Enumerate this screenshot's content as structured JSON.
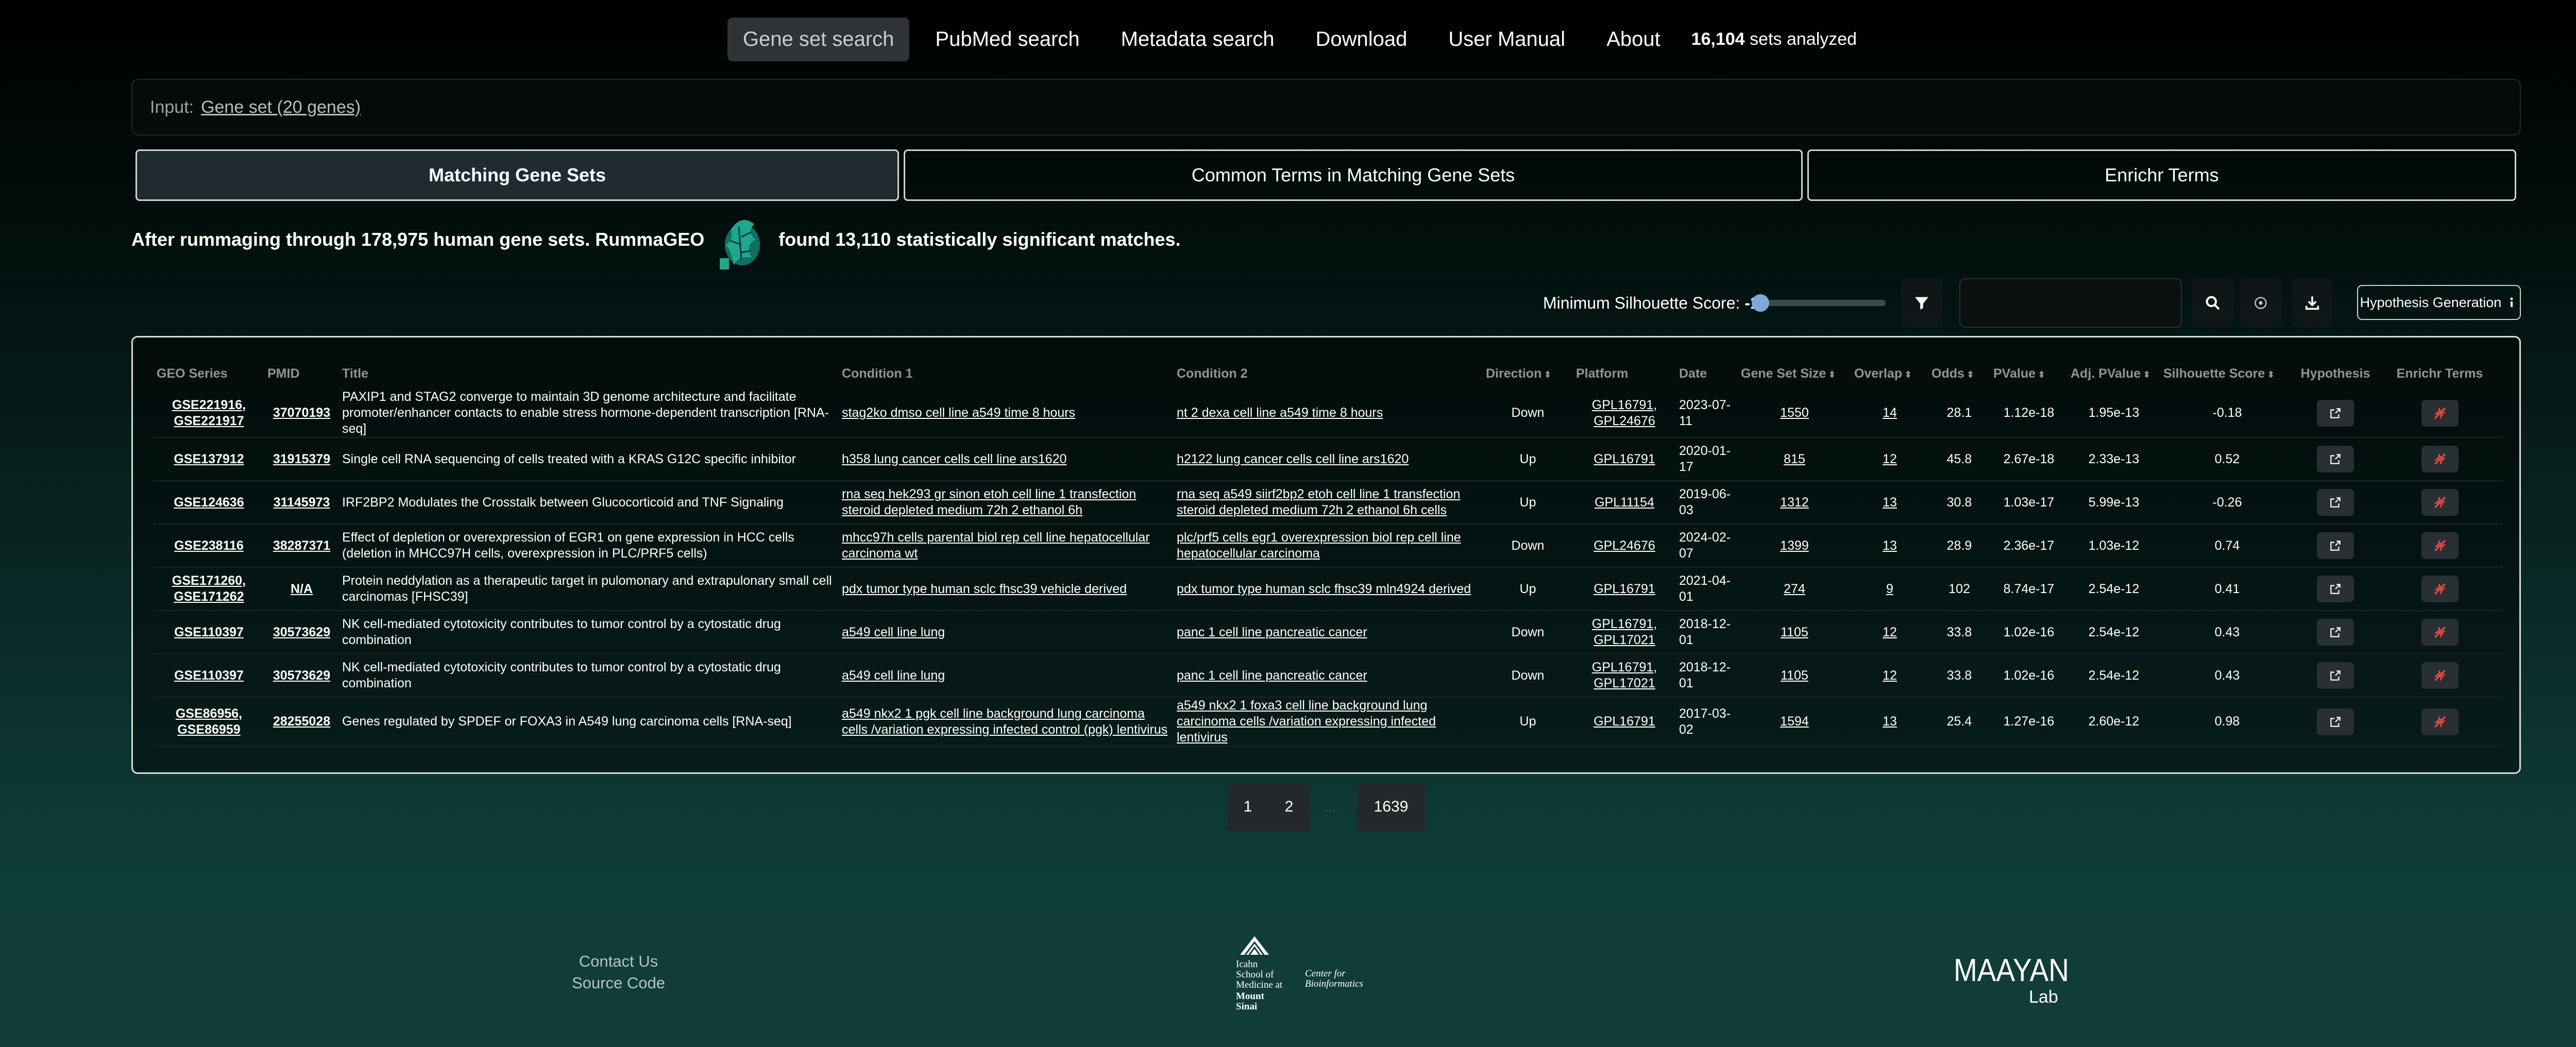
{
  "nav": {
    "items": [
      "Gene set search",
      "PubMed search",
      "Metadata search",
      "Download",
      "User Manual",
      "About"
    ],
    "sets_count": "16,104",
    "sets_suffix": "sets analyzed"
  },
  "input": {
    "label": "Input:",
    "link": "Gene set (20 genes)"
  },
  "tabs": [
    "Matching Gene Sets",
    "Common Terms in Matching Gene Sets",
    "Enrichr Terms"
  ],
  "summary": {
    "before": "After rummaging through 178,975 human gene sets. RummaGEO",
    "after": "found 13,110 statistically significant matches."
  },
  "controls": {
    "silhouette_label": "Minimum Silhouette Score:",
    "silhouette_value": "-1",
    "hypothesis_button": "Hypothesis Generation"
  },
  "table": {
    "headers": [
      "GEO Series",
      "PMID",
      "Title",
      "Condition 1",
      "Condition 2",
      "Direction",
      "Platform",
      "Date",
      "Gene Set Size",
      "Overlap",
      "Odds",
      "PValue",
      "Adj. PValue",
      "Silhouette Score",
      "Hypothesis",
      "Enrichr Terms"
    ],
    "rows": [
      {
        "geo": "GSE221916, GSE221917",
        "pmid": "37070193",
        "title": "PAXIP1 and STAG2 converge to maintain 3D genome architecture and facilitate promoter/enhancer contacts to enable stress hormone-dependent transcription [RNA-seq]",
        "cond1": "stag2ko dmso cell line a549 time 8 hours",
        "cond2": "nt 2 dexa cell line a549 time 8 hours",
        "direction": "Down",
        "platform": "GPL16791, GPL24676",
        "date": "2023-07-11",
        "size": "1550",
        "overlap": "14",
        "odds": "28.1",
        "pvalue": "1.12e-18",
        "adjp": "1.95e-13",
        "sil": "-0.18"
      },
      {
        "geo": "GSE137912",
        "pmid": "31915379",
        "title": "Single cell RNA sequencing of cells treated with a KRAS G12C specific inhibitor",
        "cond1": "h358 lung cancer cells cell line ars1620",
        "cond2": "h2122 lung cancer cells cell line ars1620",
        "direction": "Up",
        "platform": "GPL16791",
        "date": "2020-01-17",
        "size": "815",
        "overlap": "12",
        "odds": "45.8",
        "pvalue": "2.67e-18",
        "adjp": "2.33e-13",
        "sil": "0.52"
      },
      {
        "geo": "GSE124636",
        "pmid": "31145973",
        "title": "IRF2BP2 Modulates the Crosstalk between Glucocorticoid and TNF Signaling",
        "cond1": "rna seq hek293 gr sinon etoh cell line 1 transfection steroid depleted medium 72h 2 ethanol 6h",
        "cond2": "rna seq a549 siirf2bp2 etoh cell line 1 transfection steroid depleted medium 72h 2 ethanol 6h cells",
        "direction": "Up",
        "platform": "GPL11154",
        "date": "2019-06-03",
        "size": "1312",
        "overlap": "13",
        "odds": "30.8",
        "pvalue": "1.03e-17",
        "adjp": "5.99e-13",
        "sil": "-0.26"
      },
      {
        "geo": "GSE238116",
        "pmid": "38287371",
        "title": "Effect of depletion or overexpression of EGR1 on gene expression in HCC cells (deletion in MHCC97H cells, overexpression in PLC/PRF5 cells)",
        "cond1": "mhcc97h cells parental biol rep cell line hepatocellular carcinoma wt",
        "cond2": "plc/prf5 cells egr1 overexpression biol rep cell line hepatocellular carcinoma",
        "direction": "Down",
        "platform": "GPL24676",
        "date": "2024-02-07",
        "size": "1399",
        "overlap": "13",
        "odds": "28.9",
        "pvalue": "2.36e-17",
        "adjp": "1.03e-12",
        "sil": "0.74"
      },
      {
        "geo": "GSE171260, GSE171262",
        "pmid": "N/A",
        "title": "Protein neddylation as a therapeutic target in pulomonary and extrapulonary small cell carcinomas [FHSC39]",
        "cond1": "pdx tumor type human sclc fhsc39 vehicle derived",
        "cond2": "pdx tumor type human sclc fhsc39 mln4924 derived",
        "direction": "Up",
        "platform": "GPL16791",
        "date": "2021-04-01",
        "size": "274",
        "overlap": "9",
        "odds": "102",
        "pvalue": "8.74e-17",
        "adjp": "2.54e-12",
        "sil": "0.41"
      },
      {
        "geo": "GSE110397",
        "pmid": "30573629",
        "title": "NK cell-mediated cytotoxicity contributes to tumor control by a cytostatic drug combination",
        "cond1": "a549 cell line lung",
        "cond2": "panc 1 cell line pancreatic cancer",
        "direction": "Down",
        "platform": "GPL16791, GPL17021",
        "date": "2018-12-01",
        "size": "1105",
        "overlap": "12",
        "odds": "33.8",
        "pvalue": "1.02e-16",
        "adjp": "2.54e-12",
        "sil": "0.43"
      },
      {
        "geo": "GSE110397",
        "pmid": "30573629",
        "title": "NK cell-mediated cytotoxicity contributes to tumor control by a cytostatic drug combination",
        "cond1": "a549 cell line lung",
        "cond2": "panc 1 cell line pancreatic cancer",
        "direction": "Down",
        "platform": "GPL16791, GPL17021",
        "date": "2018-12-01",
        "size": "1105",
        "overlap": "12",
        "odds": "33.8",
        "pvalue": "1.02e-16",
        "adjp": "2.54e-12",
        "sil": "0.43"
      },
      {
        "geo": "GSE86956, GSE86959",
        "pmid": "28255028",
        "title": "Genes regulated by SPDEF or FOXA3 in A549 lung carcinoma cells [RNA-seq]",
        "cond1": "a549 nkx2 1 pgk cell line background lung carcinoma cells /variation expressing infected control (pgk) lentivirus",
        "cond2": "a549 nkx2 1 foxa3 cell line background lung carcinoma cells /variation expressing infected lentivirus",
        "direction": "Up",
        "platform": "GPL16791",
        "date": "2017-03-02",
        "size": "1594",
        "overlap": "13",
        "odds": "25.4",
        "pvalue": "1.27e-16",
        "adjp": "2.60e-12",
        "sil": "0.98"
      }
    ]
  },
  "pagination": {
    "pages": [
      "1",
      "2"
    ],
    "ellipsis": "...",
    "last": "1639"
  },
  "footer": {
    "contact": "Contact Us",
    "source": "Source Code",
    "ismms_lines": [
      "Icahn",
      "School of",
      "Medicine at",
      "Mount",
      "Sinai"
    ],
    "ismms_center": [
      "Center for",
      "Bioinformatics"
    ],
    "maayan_logo": "MAAYAN",
    "maayan_lab": "Lab"
  },
  "icons": {
    "filter": "filter-icon",
    "search": "search-icon",
    "reset": "target-icon",
    "download": "download-icon",
    "info": "info-icon",
    "hypothesis": "external-link-icon",
    "enrichr": "dna-icon"
  },
  "colors": {
    "active_nav": "#2f3338",
    "table_border": "#d8dede",
    "enrichr_icon": "#e04b4b",
    "slider_thumb": "#7fa7d8"
  }
}
